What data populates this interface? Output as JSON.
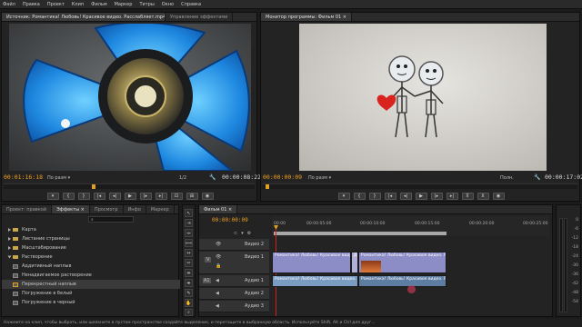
{
  "menu": [
    "Файл",
    "Правка",
    "Проект",
    "Клип",
    "Фильм",
    "Маркер",
    "Титры",
    "Окно",
    "Справка"
  ],
  "source_panel": {
    "tabs": [
      "Источник: Романтика! Любовь! Красивое видео. Расслабляет.mp4 ×",
      "Управление эффектами"
    ],
    "timecode_left": "00:01:16:18",
    "fit": "По разм ▾",
    "quality": "1/2",
    "timecode_right": "00:00:08:22"
  },
  "program_panel": {
    "tabs": [
      "Монитор программы: Фильм 01 ×"
    ],
    "timecode_left": "00:00:00:09",
    "fit": "По разм ▾",
    "quality": "Полн.",
    "timecode_right": "00:00:17:02"
  },
  "effects_panel": {
    "tabs": [
      "Проект: правкой",
      "Эффекты ×",
      "Просмотр",
      "Инфо",
      "Маркер"
    ],
    "items": [
      {
        "label": "Карта",
        "kind": "folder"
      },
      {
        "label": "Листание страницы",
        "kind": "folder"
      },
      {
        "label": "Масштабирование",
        "kind": "folder"
      },
      {
        "label": "Растворение",
        "kind": "folder-open"
      },
      {
        "label": "Аддитивный наплыв",
        "kind": "fx"
      },
      {
        "label": "Ненадвигаемое растворение",
        "kind": "fx"
      },
      {
        "label": "Перекрестный наплыв",
        "kind": "fx"
      },
      {
        "label": "Погружение в белый",
        "kind": "fx"
      },
      {
        "label": "Погружение в черный",
        "kind": "fx"
      }
    ]
  },
  "timeline": {
    "tab": "Фильм 01 ×",
    "timecode": "00:00:00:09",
    "ruler": [
      "00:00",
      "00:00:05:00",
      "00:00:10:00",
      "00:00:15:00",
      "00:00:20:00",
      "00:00:25:00"
    ],
    "tracks": {
      "video2": "Видео 2",
      "video1": "Видео 1",
      "audio1": "Аудио 1",
      "audio2": "Аудио 2",
      "audio3": "Аудио 3",
      "v_label": "V",
      "a1_label": "A1"
    },
    "clips": {
      "v1_a": "Романтика! Любовь! Красивое видео. Расслаб",
      "v1_b": "Дер",
      "v1_c": "Романтика! Любовь! Красивое видео. Расслаб",
      "a1_a": "Романтика! Любовь! Красивое видео. Расслаб",
      "a1_b": "Романтика! Любовь! Красивое видео. Р"
    }
  },
  "meter_scale": [
    "0",
    "-6",
    "-12",
    "-18",
    "-24",
    "-30",
    "-36",
    "-42",
    "-48",
    "-54"
  ],
  "status": "Нажмите на клип, чтобы выбрать, или щелкните в пустом пространстве создайте выделение, и перетащите в выбранную область. Используйте Shift, Alt и Ctrl для друг..."
}
